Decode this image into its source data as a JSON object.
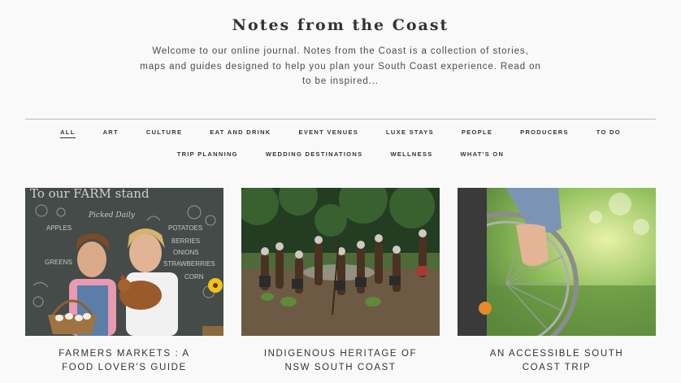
{
  "page": {
    "title": "Notes from the Coast",
    "intro": "Welcome to our online journal. Notes from the Coast is a collection of stories, maps and guides designed to help you plan your South Coast experience. Read on to be inspired..."
  },
  "filters": [
    {
      "label": "ALL",
      "active": true
    },
    {
      "label": "ART"
    },
    {
      "label": "CULTURE"
    },
    {
      "label": "EAT AND DRINK"
    },
    {
      "label": "EVENT VENUES"
    },
    {
      "label": "LUXE STAYS"
    },
    {
      "label": "PEOPLE"
    },
    {
      "label": "PRODUCERS"
    },
    {
      "label": "TO DO"
    },
    {
      "label": "TRIP PLANNING"
    },
    {
      "label": "WEDDING DESTINATIONS"
    },
    {
      "label": "WELLNESS"
    },
    {
      "label": "WHAT'S ON"
    }
  ],
  "articles": [
    {
      "line1": "FARMERS MARKETS : A",
      "line2": "FOOD LOVER'S GUIDE",
      "image": "two children with basket of eggs and chicken in front of farm chalkboard",
      "board_title": "To our FARM stand",
      "board_sub": "Picked Daily",
      "board_items": [
        "APPLES",
        "POTATOES",
        "BERRIES",
        "ONIONS",
        "GREENS",
        "STRAWBERRIES",
        "CORN"
      ]
    },
    {
      "line1": "INDIGENOUS HERITAGE OF",
      "line2": "NSW SOUTH COAST",
      "image": "group of Aboriginal dancers in a forest clearing"
    },
    {
      "line1": "AN ACCESSIBLE SOUTH",
      "line2": "COAST TRIP",
      "image": "hand on wheelchair wheel with green garden background"
    }
  ],
  "colors": {
    "background": "#f9f9f9",
    "text": "#333333",
    "rule": "#b8b8b8"
  }
}
